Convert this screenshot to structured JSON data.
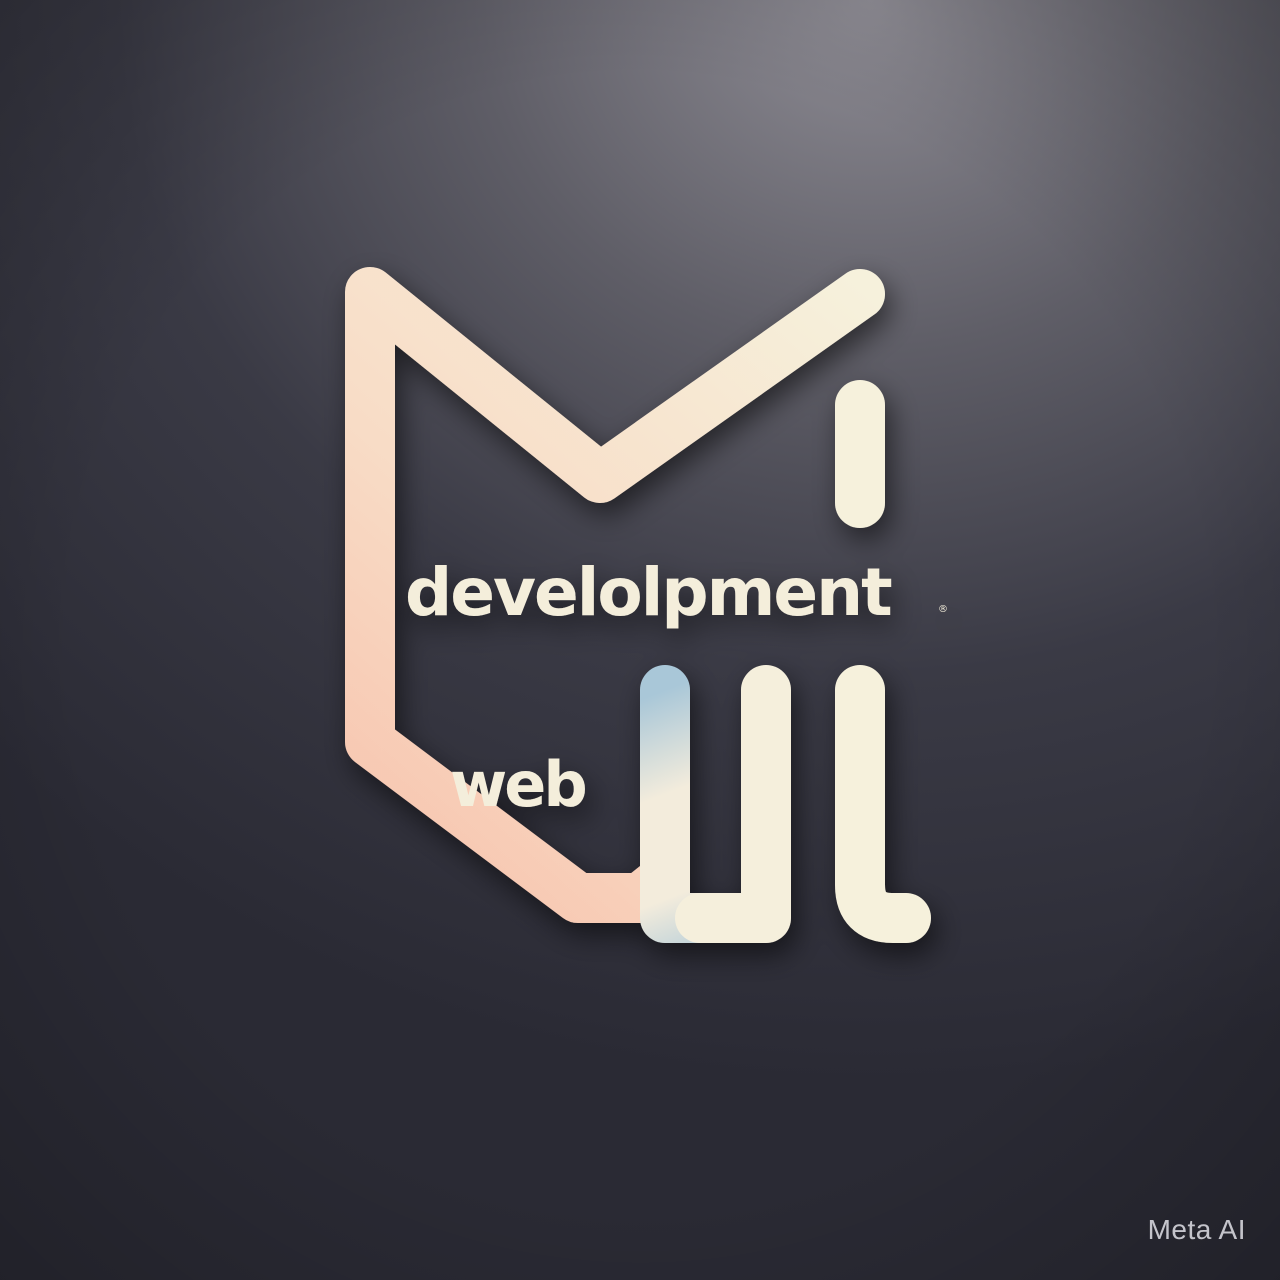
{
  "logo": {
    "word_top": "develolpment",
    "word_bottom": "web",
    "trademark_mark": "®"
  },
  "watermark": {
    "label": "Meta AI"
  },
  "colors": {
    "background_light": "#8f8d95",
    "background_dark": "#2a2a34",
    "stroke_peach": "#f7c9b2",
    "stroke_cream": "#f6f1dc",
    "accent_blue": "#a9c7d8",
    "text_cream": "#f4eedb"
  }
}
